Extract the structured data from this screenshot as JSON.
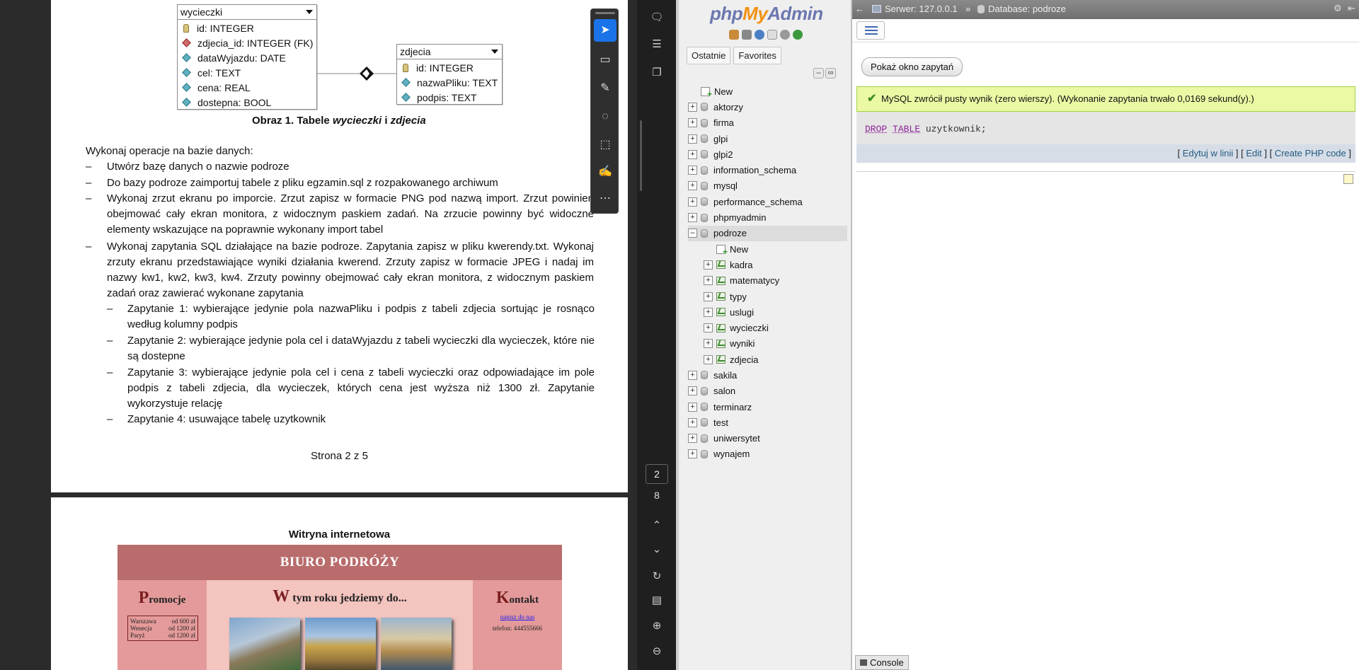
{
  "pdf": {
    "er": {
      "table1": {
        "name": "wycieczki",
        "rows": [
          "id: INTEGER",
          "zdjecia_id: INTEGER (FK)",
          "dataWyjazdu: DATE",
          "cel: TEXT",
          "cena: REAL",
          "dostepna: BOOL"
        ]
      },
      "table2": {
        "name": "zdjecia",
        "rows": [
          "id: INTEGER",
          "nazwaPliku: TEXT",
          "podpis: TEXT"
        ]
      },
      "caption_prefix": "Obraz 1. Tabele ",
      "caption_t1": "wycieczki",
      "caption_and": " i ",
      "caption_t2": "zdjecia"
    },
    "intro": "Wykonaj operacje na bazie danych:",
    "items": [
      "Utwórz bazę danych o nazwie podroze",
      "Do bazy podroze zaimportuj tabele z pliku egzamin.sql z rozpakowanego archiwum",
      "Wykonaj zrzut ekranu po imporcie. Zrzut zapisz w formacie PNG pod nazwą import. Zrzut powinien obejmować cały ekran monitora, z widocznym paskiem zadań. Na zrzucie powinny być widoczne elementy wskazujące na poprawnie wykonany import tabel",
      "Wykonaj zapytania SQL działające na bazie podroze. Zapytania zapisz w pliku kwerendy.txt. Wykonaj zrzuty ekranu przedstawiające wyniki działania kwerend. Zrzuty zapisz w formacie JPEG i nadaj im nazwy kw1, kw2, kw3, kw4. Zrzuty powinny obejmować cały ekran monitora, z widocznym paskiem zadań oraz zawierać wykonane zapytania"
    ],
    "subitems": [
      "Zapytanie 1: wybierające jedynie pola nazwaPliku i podpis z tabeli zdjecia sortując je rosnąco według kolumny podpis",
      "Zapytanie 2: wybierające jedynie pola cel i dataWyjazdu z tabeli wycieczki dla wycieczek, które nie są dostepne",
      "Zapytanie 3: wybierające jedynie pola cel i cena z tabeli wycieczki oraz odpowiadające im pole podpis z tabeli zdjecia, dla wycieczek, których cena jest wyższa niż 1300 zł. Zapytanie wykorzystuje relację",
      "Zapytanie 4: usuwające tabelę uzytkownik"
    ],
    "footer": "Strona 2 z 5",
    "page2": {
      "heading": "Witryna internetowa",
      "banner": "BIURO PODRÓŻY",
      "left_title_big": "P",
      "left_title_rest": "romocje",
      "promo_rows": [
        {
          "city": "Warszawa",
          "price": "od 600 zł"
        },
        {
          "city": "Wenecja",
          "price": "od 1200 zł"
        },
        {
          "city": "Paryż",
          "price": "od 1200 zł"
        }
      ],
      "mid_title_big": "W",
      "mid_title_rest": " tym roku jedziemy do...",
      "right_title_big": "K",
      "right_title_rest": "ontakt",
      "contact_link": "napisz do nas",
      "contact_phone": "telefon: 444555666"
    },
    "page_current": "2",
    "page_total": "8",
    "toolbar_icons": [
      "cursor-icon",
      "add-comment-icon",
      "highlight-icon",
      "draw-icon",
      "text-select-icon",
      "sign-icon",
      "more-icon"
    ]
  },
  "pma": {
    "logo_php": "php",
    "logo_my": "My",
    "logo_admin": "Admin",
    "tabs": [
      "Ostatnie",
      "Favorites"
    ],
    "tree": [
      {
        "label": "New",
        "type": "new",
        "level": 0
      },
      {
        "label": "aktorzy",
        "type": "db",
        "level": 0
      },
      {
        "label": "firma",
        "type": "db",
        "level": 0
      },
      {
        "label": "glpi",
        "type": "db",
        "level": 0
      },
      {
        "label": "glpi2",
        "type": "db",
        "level": 0
      },
      {
        "label": "information_schema",
        "type": "db",
        "level": 0
      },
      {
        "label": "mysql",
        "type": "db",
        "level": 0
      },
      {
        "label": "performance_schema",
        "type": "db",
        "level": 0
      },
      {
        "label": "phpmyadmin",
        "type": "db",
        "level": 0
      },
      {
        "label": "podroze",
        "type": "db-open",
        "level": 0
      },
      {
        "label": "New",
        "type": "new",
        "level": 1
      },
      {
        "label": "kadra",
        "type": "table",
        "level": 1
      },
      {
        "label": "matematycy",
        "type": "table",
        "level": 1
      },
      {
        "label": "typy",
        "type": "table",
        "level": 1
      },
      {
        "label": "uslugi",
        "type": "table",
        "level": 1
      },
      {
        "label": "wycieczki",
        "type": "table",
        "level": 1
      },
      {
        "label": "wyniki",
        "type": "table",
        "level": 1
      },
      {
        "label": "zdjecia",
        "type": "table",
        "level": 1
      },
      {
        "label": "sakila",
        "type": "db",
        "level": 0
      },
      {
        "label": "salon",
        "type": "db",
        "level": 0
      },
      {
        "label": "terminarz",
        "type": "db",
        "level": 0
      },
      {
        "label": "test",
        "type": "db",
        "level": 0
      },
      {
        "label": "uniwersytet",
        "type": "db",
        "level": 0
      },
      {
        "label": "wynajem",
        "type": "db",
        "level": 0
      }
    ],
    "breadcrumb": {
      "server": "Serwer: 127.0.0.1",
      "sep": "»",
      "database": "Database: podroze"
    },
    "show_query_button": "Pokaż okno zapytań",
    "success_message": "MySQL zwrócił pusty wynik (zero wierszy). (Wykonanie zapytania trwało 0,0169 sekund(y).)",
    "sql": {
      "kw1": "DROP",
      "kw2": "TABLE",
      "rest": " uzytkownik;"
    },
    "links": {
      "edit_inline": "Edytuj w linii",
      "edit": "Edit",
      "create_php": "Create PHP code"
    },
    "console": "Console",
    "colors": {
      "success_bg": "#ebf8a4",
      "link": "#235a81",
      "sql_keyword": "#8b2296"
    }
  }
}
